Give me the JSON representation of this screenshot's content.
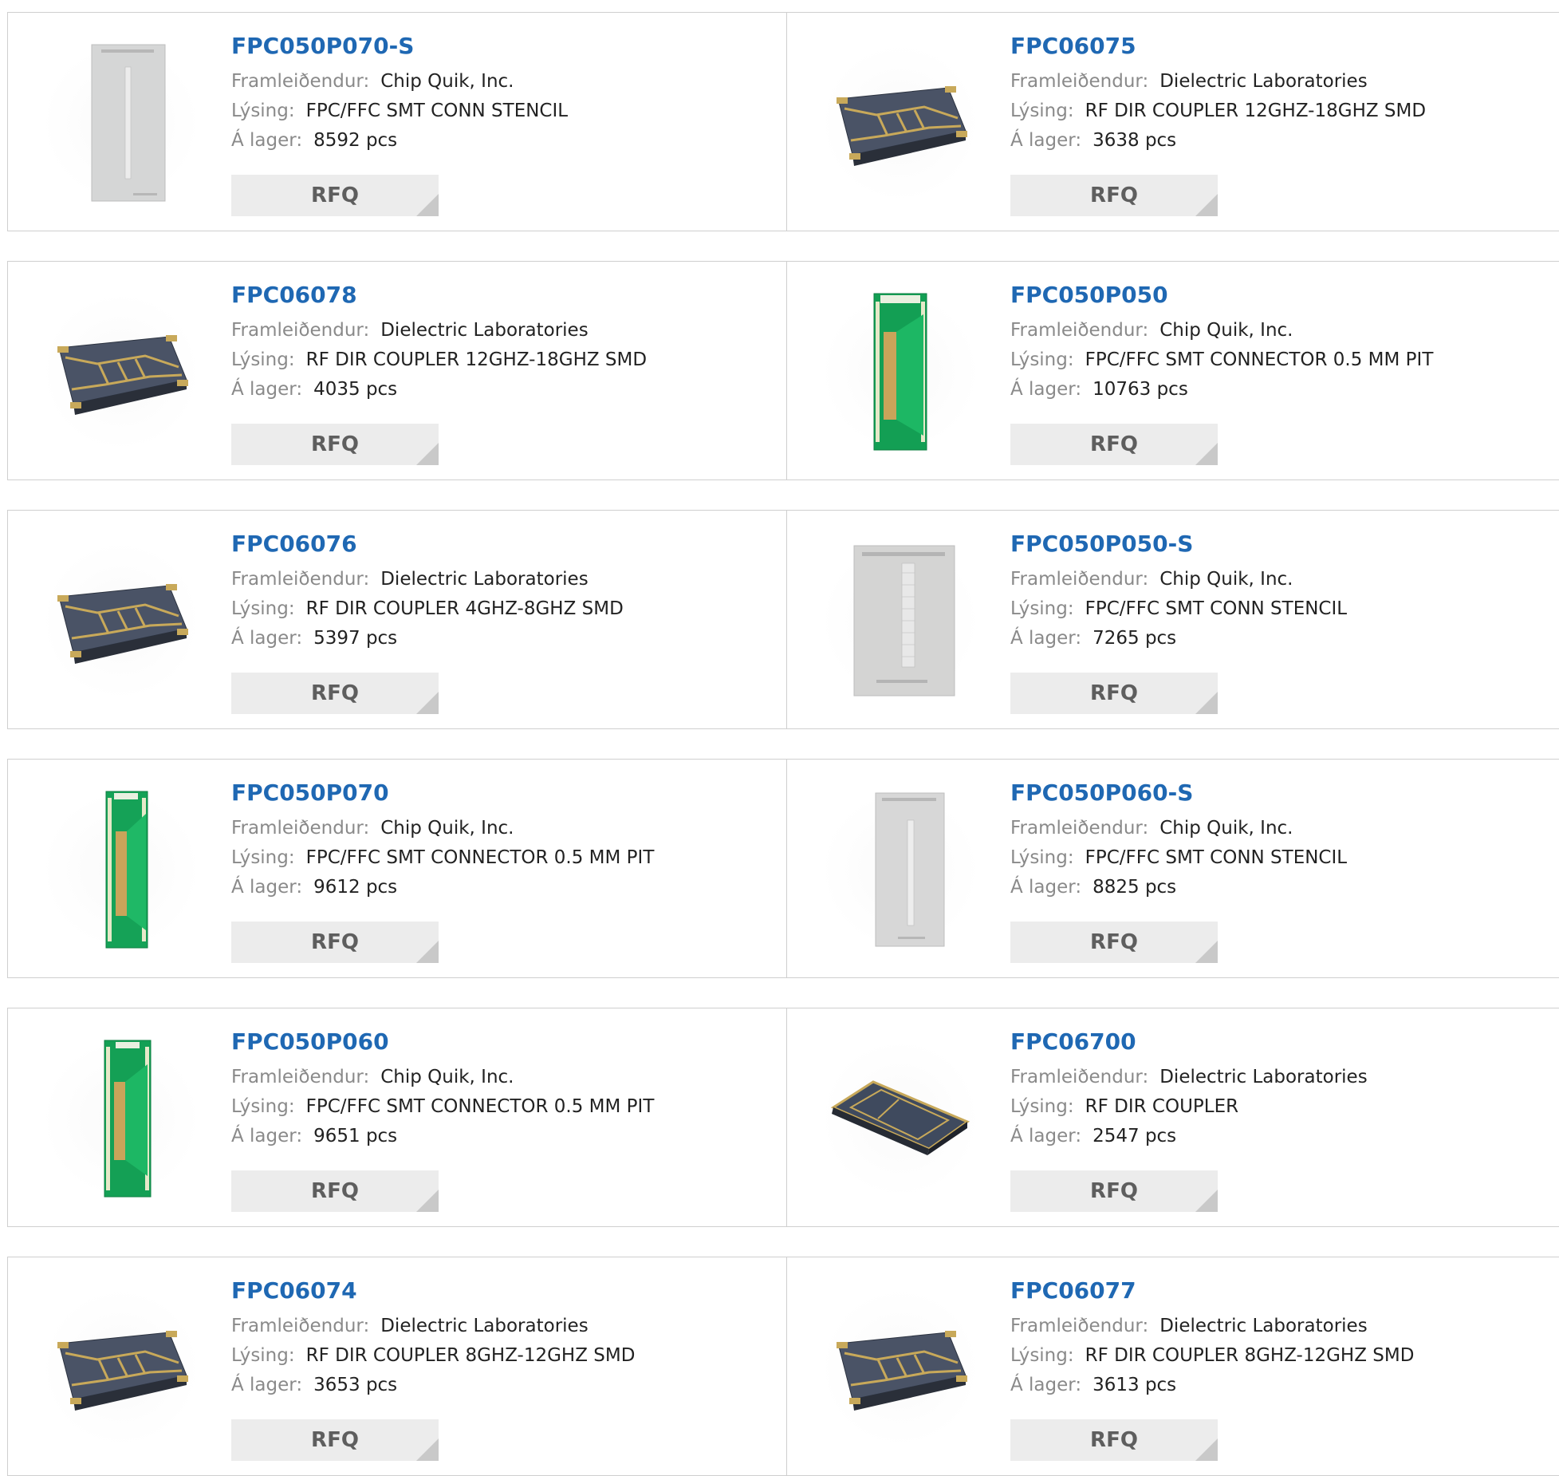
{
  "labels": {
    "manufacturer": "Framleiðendur:",
    "description": "Lýsing:",
    "stock": "Á lager:"
  },
  "products": [
    {
      "part": "FPC050P070-S",
      "manufacturer": "Chip Quik, Inc.",
      "description": "FPC/FFC SMT CONN STENCIL",
      "stock": "8592 pcs",
      "button": "RFQ",
      "image": "stencil-narrow"
    },
    {
      "part": "FPC06075",
      "manufacturer": "Dielectric Laboratories",
      "description": "RF DIR COUPLER 12GHZ-18GHZ SMD",
      "stock": "3638 pcs",
      "button": "RFQ",
      "image": "coupler-chip"
    },
    {
      "part": "FPC06078",
      "manufacturer": "Dielectric Laboratories",
      "description": "RF DIR COUPLER 12GHZ-18GHZ SMD",
      "stock": "4035 pcs",
      "button": "RFQ",
      "image": "coupler-chip"
    },
    {
      "part": "FPC050P050",
      "manufacturer": "Chip Quik, Inc.",
      "description": "FPC/FFC SMT CONNECTOR 0.5 MM PIT",
      "stock": "10763 pcs",
      "button": "RFQ",
      "image": "green-pcb-wide"
    },
    {
      "part": "FPC06076",
      "manufacturer": "Dielectric Laboratories",
      "description": "RF DIR COUPLER 4GHZ-8GHZ SMD",
      "stock": "5397 pcs",
      "button": "RFQ",
      "image": "coupler-chip"
    },
    {
      "part": "FPC050P050-S",
      "manufacturer": "Chip Quik, Inc.",
      "description": "FPC/FFC SMT CONN STENCIL",
      "stock": "7265 pcs",
      "button": "RFQ",
      "image": "stencil-wide"
    },
    {
      "part": "FPC050P070",
      "manufacturer": "Chip Quik, Inc.",
      "description": "FPC/FFC SMT CONNECTOR 0.5 MM PIT",
      "stock": "9612 pcs",
      "button": "RFQ",
      "image": "green-pcb-narrow"
    },
    {
      "part": "FPC050P060-S",
      "manufacturer": "Chip Quik, Inc.",
      "description": "FPC/FFC SMT CONN STENCIL",
      "stock": "8825 pcs",
      "button": "RFQ",
      "image": "stencil-medium"
    },
    {
      "part": "FPC050P060",
      "manufacturer": "Chip Quik, Inc.",
      "description": "FPC/FFC SMT CONNECTOR 0.5 MM PIT",
      "stock": "9651 pcs",
      "button": "RFQ",
      "image": "green-pcb-medium"
    },
    {
      "part": "FPC06700",
      "manufacturer": "Dielectric Laboratories",
      "description": "RF DIR COUPLER",
      "stock": "2547 pcs",
      "button": "RFQ",
      "image": "coupler-plain"
    },
    {
      "part": "FPC06074",
      "manufacturer": "Dielectric Laboratories",
      "description": "RF DIR COUPLER 8GHZ-12GHZ SMD",
      "stock": "3653 pcs",
      "button": "RFQ",
      "image": "coupler-chip"
    },
    {
      "part": "FPC06077",
      "manufacturer": "Dielectric Laboratories",
      "description": "RF DIR COUPLER 8GHZ-12GHZ SMD",
      "stock": "3613 pcs",
      "button": "RFQ",
      "image": "coupler-chip"
    }
  ]
}
